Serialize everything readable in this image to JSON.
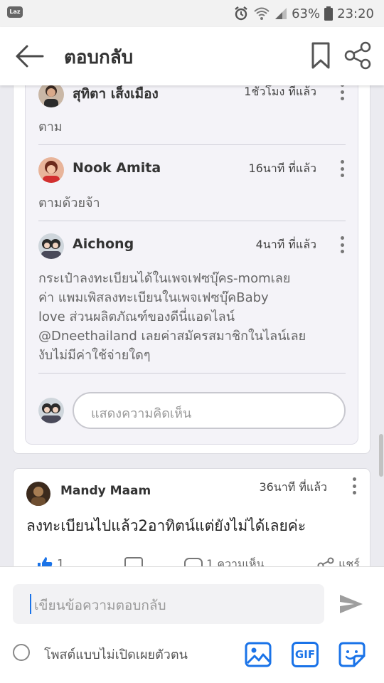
{
  "status_bar": {
    "app_icon_text": "Laz",
    "battery": "63%",
    "clock": "23:20"
  },
  "header": {
    "title": "ตอบกลับ"
  },
  "replies": [
    {
      "author": "สุทิตา เส็งเมือง",
      "time": "1ชั่วโมง ที่แล้ว",
      "text": "ตาม"
    },
    {
      "author": "Nook Amita",
      "time": "16นาที ที่แล้ว",
      "text": "ตามด้วยจ้า"
    },
    {
      "author": "Aichong",
      "time": "4นาที ที่แล้ว",
      "text": "กระเป๋าลงทะเบียนได้ในเพจเฟซบุ๊คs-momเลย\nค่า แพมเพิสลงทะเบียนในเพจเฟซบุ๊คBaby\nlove ส่วนผลิตภัณฑ์ของดีนี่แอดไลน์\n@Dneethailand เลยค่าสมัครสมาชิกในไลน์เลย\nงับไม่มีค่าใช้จ่ายใดๆ"
    }
  ],
  "comment_box": {
    "placeholder": "แสดงความคิดเห็น"
  },
  "second_comment": {
    "author": "Mandy Maam",
    "time": "36นาที ที่แล้ว",
    "text": "ลงทะเบียนไปแล้ว2อาทิตน์แต่ยังไม่ได้เลยค่ะ",
    "actions": {
      "likes": "1",
      "comments_label": "1 ความเห็น",
      "share_label": "แชร์"
    }
  },
  "compose": {
    "placeholder": "เขียนข้อความตอบกลับ",
    "anonymous_label": "โพสต์แบบไม่เปิดเผยตัวตน",
    "gif_label": "GIF"
  },
  "colors": {
    "accent": "#1a73e8",
    "thread_bg": "#f4f3f8"
  }
}
